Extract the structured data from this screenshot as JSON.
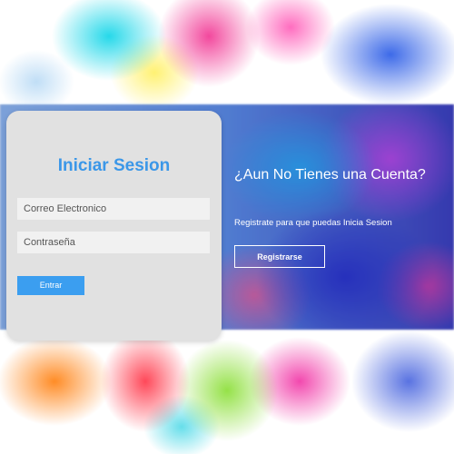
{
  "login": {
    "title": "Iniciar Sesion",
    "email_placeholder": "Correo Electronico",
    "password_placeholder": "Contraseña",
    "submit_label": "Entrar"
  },
  "signup": {
    "title": "¿Aun No Tienes una Cuenta?",
    "text": "Registrate para que puedas Inicia Sesion",
    "button_label": "Registrarse"
  },
  "colors": {
    "accent": "#3b9ef0",
    "title": "#3b97e8",
    "card_bg": "#e1e1e1"
  }
}
